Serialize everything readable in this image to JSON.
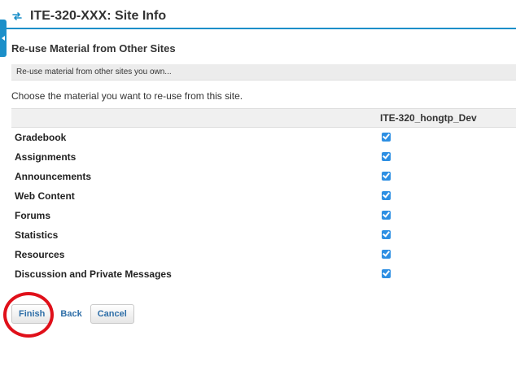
{
  "header": {
    "title": "ITE-320-XXX: Site Info",
    "icon": "sync-arrows-icon"
  },
  "section": {
    "title": "Re-use Material from Other Sites",
    "info": "Re-use material from other sites you own...",
    "instructions": "Choose the material you want to re-use from this site."
  },
  "table": {
    "tool_header": "",
    "site_column": "ITE-320_hongtp_Dev",
    "rows": [
      {
        "label": "Gradebook",
        "checked": true
      },
      {
        "label": "Assignments",
        "checked": true
      },
      {
        "label": "Announcements",
        "checked": true
      },
      {
        "label": "Web Content",
        "checked": true
      },
      {
        "label": "Forums",
        "checked": true
      },
      {
        "label": "Statistics",
        "checked": true
      },
      {
        "label": "Resources",
        "checked": true
      },
      {
        "label": "Discussion and Private Messages",
        "checked": true
      }
    ]
  },
  "buttons": {
    "finish": "Finish",
    "back": "Back",
    "cancel": "Cancel"
  },
  "colors": {
    "accent": "#1b8fc9",
    "checkbox": "#2d8fe3",
    "annotation": "#e0101a"
  }
}
